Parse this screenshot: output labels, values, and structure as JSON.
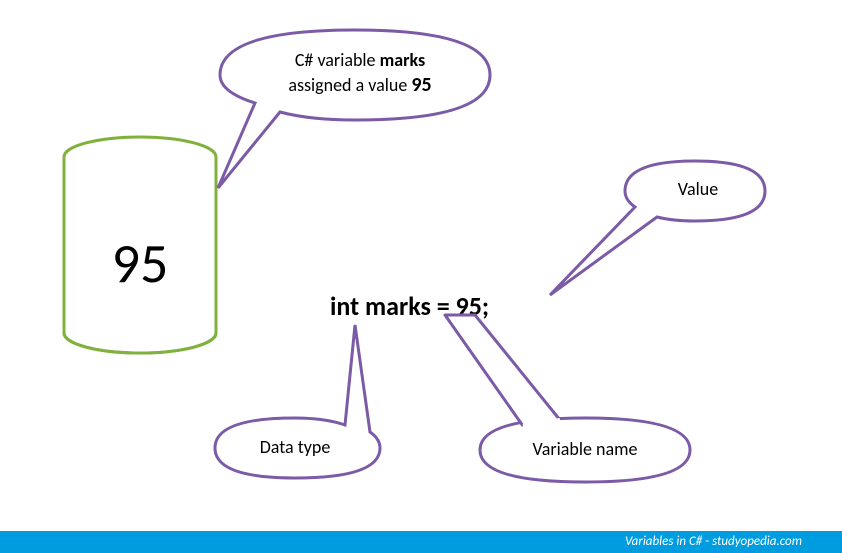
{
  "colors": {
    "cylinder_stroke": "#7fb13c",
    "bubble_stroke": "#7b5aa6",
    "footer_bg": "#009ce0",
    "footer_text": "#ffffff"
  },
  "cylinder": {
    "value": "95"
  },
  "bubbles": {
    "top": {
      "line1_prefix": "C# variable ",
      "line1_bold": "marks",
      "line2_prefix": "assigned a value  ",
      "line2_bold": "95"
    },
    "value": {
      "label": "Value"
    },
    "datatype": {
      "label": "Data type"
    },
    "varname": {
      "label": "Variable name"
    }
  },
  "code": {
    "text": "int marks = 95;"
  },
  "footer": {
    "text": "Variables in C# - studyopedia.com"
  }
}
